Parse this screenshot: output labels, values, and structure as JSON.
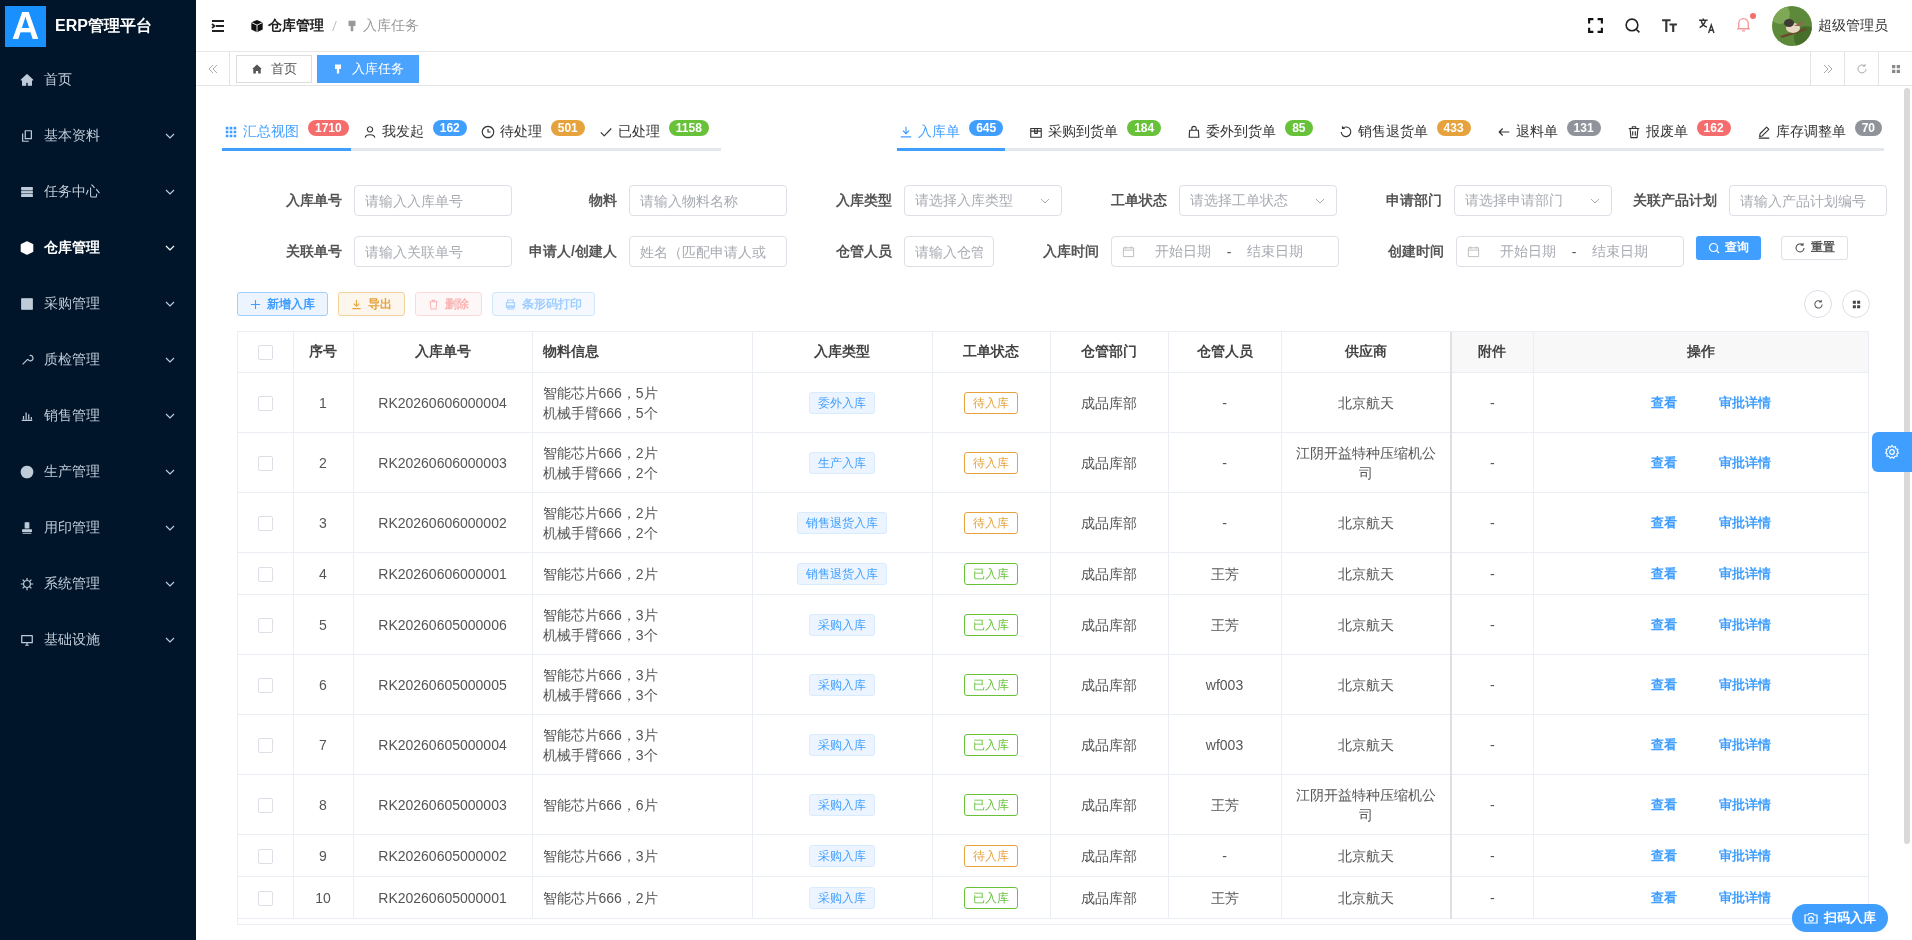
{
  "sidebar": {
    "logo": "A",
    "title": "ERP管理平台",
    "items": [
      {
        "label": "首页",
        "expandable": false,
        "active": false
      },
      {
        "label": "基本资料",
        "expandable": true,
        "active": false
      },
      {
        "label": "任务中心",
        "expandable": true,
        "active": false
      },
      {
        "label": "仓库管理",
        "expandable": true,
        "active": true
      },
      {
        "label": "采购管理",
        "expandable": true,
        "active": false
      },
      {
        "label": "质检管理",
        "expandable": true,
        "active": false
      },
      {
        "label": "销售管理",
        "expandable": true,
        "active": false
      },
      {
        "label": "生产管理",
        "expandable": true,
        "active": false
      },
      {
        "label": "用印管理",
        "expandable": true,
        "active": false
      },
      {
        "label": "系统管理",
        "expandable": true,
        "active": false
      },
      {
        "label": "基础设施",
        "expandable": true,
        "active": false
      }
    ]
  },
  "header": {
    "breadcrumb": [
      "仓库管理",
      "入库任务"
    ],
    "user": "超级管理员",
    "notification_dot": true
  },
  "tags": [
    {
      "label": "首页",
      "selected": false
    },
    {
      "label": "入库任务",
      "selected": true
    }
  ],
  "tab_groups": [
    [
      {
        "label": "汇总视图",
        "count": "1710",
        "color": "#f56c6c",
        "selected": true
      },
      {
        "label": "我发起",
        "count": "162",
        "color": "#409eff",
        "selected": false
      },
      {
        "label": "待处理",
        "count": "501",
        "color": "#e6a23c",
        "selected": false
      },
      {
        "label": "已处理",
        "count": "1158",
        "color": "#67c23a",
        "selected": false
      }
    ],
    [
      {
        "label": "入库单",
        "count": "645",
        "color": "#409eff",
        "selected": true
      },
      {
        "label": "采购到货单",
        "count": "184",
        "color": "#67c23a",
        "selected": false
      },
      {
        "label": "委外到货单",
        "count": "85",
        "color": "#67c23a",
        "selected": false
      },
      {
        "label": "销售退货单",
        "count": "433",
        "color": "#e6a23c",
        "selected": false
      },
      {
        "label": "退料单",
        "count": "131",
        "color": "#909399",
        "selected": false
      },
      {
        "label": "报废单",
        "count": "162",
        "color": "#f56c6c",
        "selected": false
      },
      {
        "label": "库存调整单",
        "count": "70",
        "color": "#909399",
        "selected": false
      }
    ]
  ],
  "filters": {
    "rows": [
      [
        {
          "label": "入库单号",
          "kind": "input",
          "placeholder": "请输入入库单号"
        },
        {
          "label": "物料",
          "kind": "input",
          "placeholder": "请输入物料名称"
        },
        {
          "label": "入库类型",
          "kind": "select",
          "placeholder": "请选择入库类型"
        },
        {
          "label": "工单状态",
          "kind": "select",
          "placeholder": "请选择工单状态"
        },
        {
          "label": "申请部门",
          "kind": "select",
          "placeholder": "请选择申请部门"
        },
        {
          "label": "关联产品计划",
          "kind": "input",
          "placeholder": "请输入产品计划编号"
        }
      ],
      [
        {
          "label": "关联单号",
          "kind": "input",
          "placeholder": "请输入关联单号"
        },
        {
          "label": "申请人/创建人",
          "kind": "input",
          "placeholder": "姓名（匹配申请人或"
        },
        {
          "label": "仓管人员",
          "kind": "input",
          "placeholder": "请输入仓管"
        },
        {
          "label": "入库时间",
          "kind": "daterange",
          "start_placeholder": "开始日期",
          "separator": "-",
          "end_placeholder": "结束日期"
        },
        {
          "label": "创建时间",
          "kind": "daterange",
          "start_placeholder": "开始日期",
          "separator": "-",
          "end_placeholder": "结束日期"
        }
      ]
    ],
    "search_button": "查询",
    "reset_button": "重置"
  },
  "toolbar": [
    {
      "label": "新增入库",
      "kind": "primary",
      "disabled": false
    },
    {
      "label": "导出",
      "kind": "warning",
      "disabled": false
    },
    {
      "label": "删除",
      "kind": "danger",
      "disabled": true
    },
    {
      "label": "条形码打印",
      "kind": "primary",
      "disabled": true
    }
  ],
  "table": {
    "select_all_checked": false,
    "columns": [
      "序号",
      "入库单号",
      "物料信息",
      "入库类型",
      "工单状态",
      "仓管部门",
      "仓管人员",
      "供应商",
      "附件",
      "操作"
    ],
    "rows": [
      {
        "selected": false,
        "index": "1",
        "number": "RK20260606000004",
        "materials": [
          "智能芯片666，5片",
          "机械手臂666，5个"
        ],
        "type": "委外入库",
        "status": "待入库",
        "color": "#e6a23c",
        "dept": "成品库部",
        "keeper": "-",
        "supplier": "北京航天",
        "attachment": "-",
        "actions": [
          "查看",
          "审批详情"
        ]
      },
      {
        "selected": false,
        "index": "2",
        "number": "RK20260606000003",
        "materials": [
          "智能芯片666，2片",
          "机械手臂666，2个"
        ],
        "type": "生产入库",
        "status": "待入库",
        "color": "#e6a23c",
        "dept": "成品库部",
        "keeper": "-",
        "supplier": "江阴开益特种压缩机公司",
        "attachment": "-",
        "actions": [
          "查看",
          "审批详情"
        ]
      },
      {
        "selected": false,
        "index": "3",
        "number": "RK20260606000002",
        "materials": [
          "智能芯片666，2片",
          "机械手臂666，2个"
        ],
        "type": "销售退货入库",
        "status": "待入库",
        "color": "#e6a23c",
        "dept": "成品库部",
        "keeper": "-",
        "supplier": "北京航天",
        "attachment": "-",
        "actions": [
          "查看",
          "审批详情"
        ]
      },
      {
        "selected": false,
        "index": "4",
        "number": "RK20260606000001",
        "materials": [
          "智能芯片666，2片"
        ],
        "type": "销售退货入库",
        "status": "已入库",
        "color": "#67c23a",
        "dept": "成品库部",
        "keeper": "王芳",
        "supplier": "北京航天",
        "attachment": "-",
        "actions": [
          "查看",
          "审批详情"
        ]
      },
      {
        "selected": false,
        "index": "5",
        "number": "RK20260605000006",
        "materials": [
          "智能芯片666，3片",
          "机械手臂666，3个"
        ],
        "type": "采购入库",
        "status": "已入库",
        "color": "#67c23a",
        "dept": "成品库部",
        "keeper": "王芳",
        "supplier": "北京航天",
        "attachment": "-",
        "actions": [
          "查看",
          "审批详情"
        ]
      },
      {
        "selected": false,
        "index": "6",
        "number": "RK20260605000005",
        "materials": [
          "智能芯片666，3片",
          "机械手臂666，3个"
        ],
        "type": "采购入库",
        "status": "已入库",
        "color": "#67c23a",
        "dept": "成品库部",
        "keeper": "wf003",
        "supplier": "北京航天",
        "attachment": "-",
        "actions": [
          "查看",
          "审批详情"
        ]
      },
      {
        "selected": false,
        "index": "7",
        "number": "RK20260605000004",
        "materials": [
          "智能芯片666，3片",
          "机械手臂666，3个"
        ],
        "type": "采购入库",
        "status": "已入库",
        "color": "#67c23a",
        "dept": "成品库部",
        "keeper": "wf003",
        "supplier": "北京航天",
        "attachment": "-",
        "actions": [
          "查看",
          "审批详情"
        ]
      },
      {
        "selected": false,
        "index": "8",
        "number": "RK20260605000003",
        "materials": [
          "智能芯片666，6片"
        ],
        "type": "采购入库",
        "status": "已入库",
        "color": "#67c23a",
        "dept": "成品库部",
        "keeper": "王芳",
        "supplier": "江阴开益特种压缩机公司",
        "attachment": "-",
        "actions": [
          "查看",
          "审批详情"
        ]
      },
      {
        "selected": false,
        "index": "9",
        "number": "RK20260605000002",
        "materials": [
          "智能芯片666，3片"
        ],
        "type": "采购入库",
        "status": "待入库",
        "color": "#e6a23c",
        "dept": "成品库部",
        "keeper": "-",
        "supplier": "北京航天",
        "attachment": "-",
        "actions": [
          "查看",
          "审批详情"
        ]
      },
      {
        "selected": false,
        "index": "10",
        "number": "RK20260605000001",
        "materials": [
          "智能芯片666，2片"
        ],
        "type": "采购入库",
        "status": "已入库",
        "color": "#67c23a",
        "dept": "成品库部",
        "keeper": "王芳",
        "supplier": "北京航天",
        "attachment": "-",
        "actions": [
          "查看",
          "审批详情"
        ]
      }
    ]
  },
  "scan_button": "扫码入库"
}
